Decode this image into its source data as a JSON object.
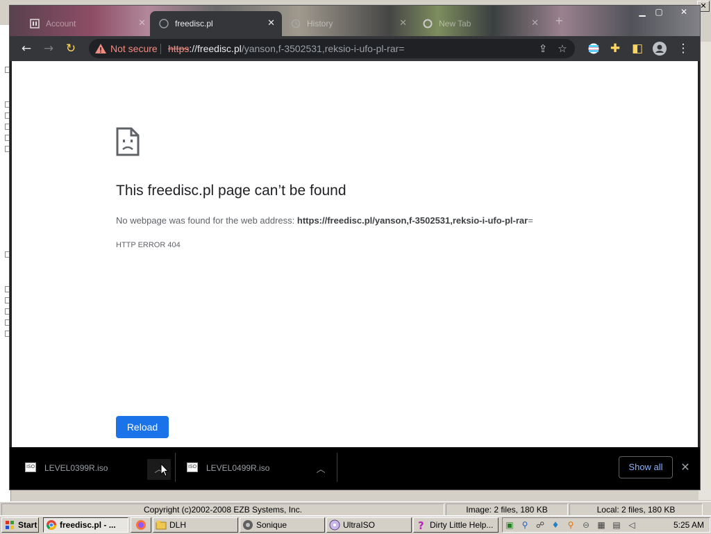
{
  "browser": {
    "tabs": [
      {
        "label": "Account",
        "state": "inactive"
      },
      {
        "label": "freedisc.pl",
        "state": "active"
      },
      {
        "label": "History",
        "state": "inactive"
      },
      {
        "label": "New Tab",
        "state": "inactive"
      }
    ],
    "omnibox": {
      "security_label": "Not secure",
      "url_scheme": "https",
      "url_host": "://freedisc.pl",
      "url_path": "/yanson,f-3502531,reksio-i-ufo-pl-rar="
    }
  },
  "error_page": {
    "title": "This freedisc.pl page can’t be found",
    "description_prefix": "No webpage was found for the web address:",
    "description_url": "https://freedisc.pl/yanson,f-3502531,reksio-i-ufo-pl-rar",
    "description_suffix": "=",
    "error_code": "HTTP ERROR 404",
    "reload_label": "Reload"
  },
  "downloads": {
    "items": [
      {
        "filename": "LEVEL0399R.iso"
      },
      {
        "filename": "LEVEL0499R.iso"
      }
    ],
    "show_all_label": "Show all"
  },
  "background_app": {
    "status_copyright": "Copyright (c)2002-2008 EZB Systems, Inc.",
    "status_image": "Image: 2 files, 180 KB",
    "status_local": "Local: 2 files, 180 KB"
  },
  "taskbar": {
    "start_label": "Start",
    "buttons": [
      {
        "label": "freedisc.pl - ..."
      },
      {
        "label": ""
      },
      {
        "label": "DLH"
      },
      {
        "label": "Sonique"
      },
      {
        "label": "UltraISO"
      },
      {
        "label": "Dirty Little Help..."
      }
    ],
    "clock": "5:25 AM"
  },
  "colors": {
    "accent_blue": "#1a73e8",
    "not_secure_red": "#f28b82",
    "link_blue": "#8ab4f8"
  }
}
